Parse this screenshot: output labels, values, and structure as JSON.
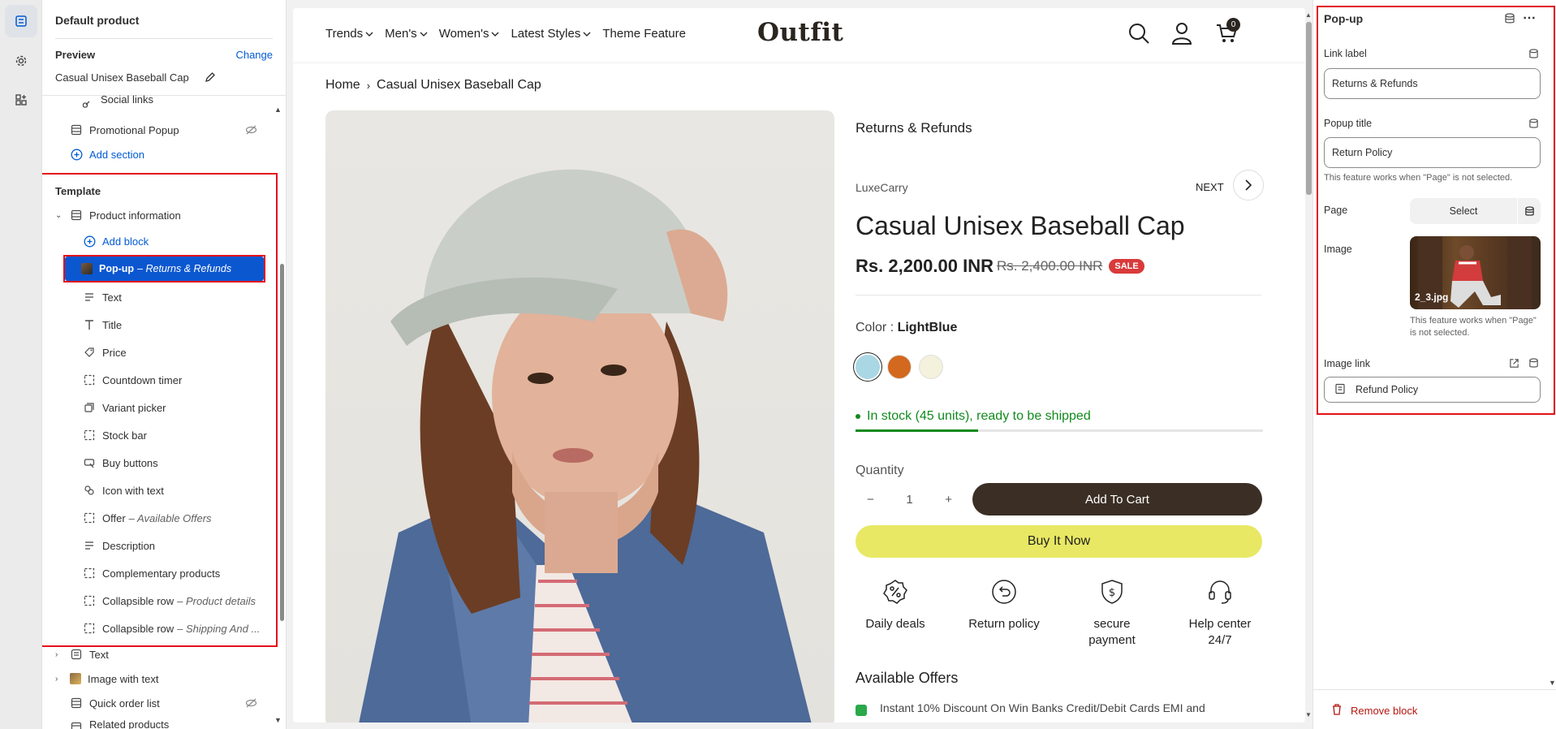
{
  "left": {
    "header_title": "Default product",
    "preview_label": "Preview",
    "change_link": "Change",
    "preview_product": "Casual Unisex Baseball Cap",
    "social_links": "Social links",
    "promotional_popup": "Promotional Popup",
    "add_section": "Add section",
    "template_label": "Template",
    "product_information": "Product information",
    "add_block": "Add block",
    "popup_block_name": "Pop-up",
    "popup_block_sub": "– Returns & Refunds",
    "blocks": [
      {
        "name": "Text",
        "sub": ""
      },
      {
        "name": "Title",
        "sub": ""
      },
      {
        "name": "Price",
        "sub": ""
      },
      {
        "name": "Countdown timer",
        "sub": ""
      },
      {
        "name": "Variant picker",
        "sub": ""
      },
      {
        "name": "Stock bar",
        "sub": ""
      },
      {
        "name": "Buy buttons",
        "sub": ""
      },
      {
        "name": "Icon with text",
        "sub": ""
      },
      {
        "name": "Offer",
        "sub": "– Available Offers"
      },
      {
        "name": "Description",
        "sub": ""
      },
      {
        "name": "Complementary products",
        "sub": ""
      },
      {
        "name": "Collapsible row",
        "sub": "– Product details"
      },
      {
        "name": "Collapsible row",
        "sub": "– Shipping And ..."
      }
    ],
    "text_section": "Text",
    "image_with_text": "Image with text",
    "quick_order_list": "Quick order list",
    "related_products": "Related products"
  },
  "preview": {
    "nav": [
      "Trends",
      "Men's",
      "Women's",
      "Latest Styles",
      "Theme Feature"
    ],
    "logo": "Outfit",
    "cart_count": "0",
    "breadcrumb_home": "Home",
    "breadcrumb_current": "Casual Unisex Baseball Cap",
    "returns_link": "Returns & Refunds",
    "vendor": "LuxeCarry",
    "next_label": "NEXT",
    "title": "Casual Unisex Baseball Cap",
    "price": "Rs. 2,200.00 INR",
    "compare_price": "Rs. 2,400.00 INR",
    "sale_badge": "SALE",
    "color_label": "Color :",
    "color_value": "LightBlue",
    "swatches": [
      "#a9d7e3",
      "#d2691e",
      "#f4f1dc"
    ],
    "stock_text": "In stock (45 units), ready to be shipped",
    "stock_fraction": 0.3,
    "quantity_label": "Quantity",
    "quantity_value": "1",
    "minus": "−",
    "plus": "+",
    "add_to_cart": "Add To Cart",
    "buy_now": "Buy It Now",
    "features": [
      {
        "icon": "percent-badge-icon",
        "line1": "Daily deals",
        "line2": ""
      },
      {
        "icon": "return-icon",
        "line1": "Return policy",
        "line2": ""
      },
      {
        "icon": "shield-dollar-icon",
        "line1": "secure",
        "line2": "payment"
      },
      {
        "icon": "headset-icon",
        "line1": "Help center",
        "line2": "24/7"
      }
    ],
    "offers_title": "Available Offers",
    "offer_text": "Instant 10% Discount On Win Banks Credit/Debit Cards EMI and"
  },
  "right": {
    "title": "Pop-up",
    "link_label_title": "Link label",
    "link_label_value": "Returns & Refunds",
    "popup_title_label": "Popup title",
    "popup_title_value": "Return Policy",
    "hint": "This feature works when \"Page\" is not selected.",
    "page_label": "Page",
    "select_label": "Select",
    "image_label": "Image",
    "image_filename": "2_3.jpg",
    "image_hint": "This feature works when \"Page\" is not selected.",
    "image_link_label": "Image link",
    "image_link_value": "Refund Policy",
    "remove_block": "Remove block"
  }
}
